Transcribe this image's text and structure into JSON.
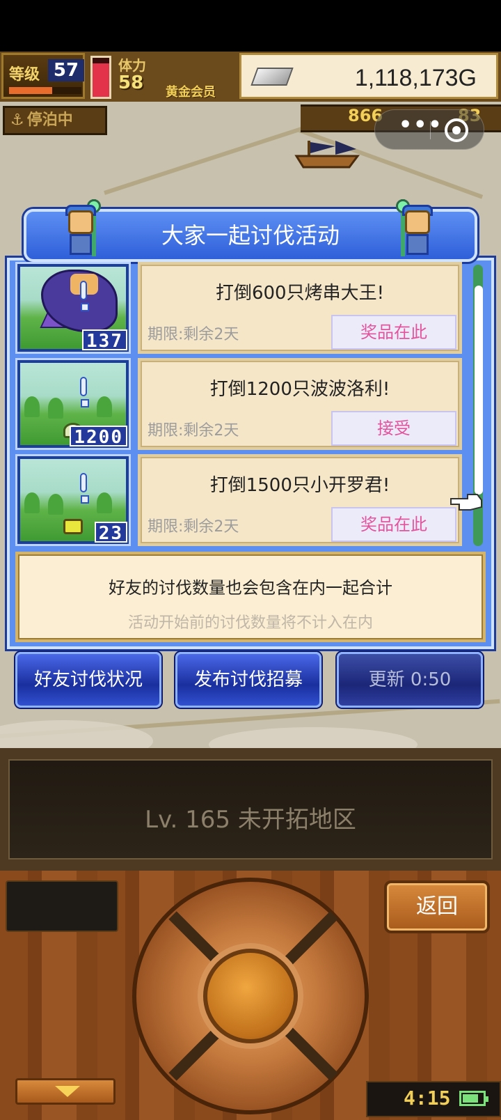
{
  "hud": {
    "level_label": "等级",
    "level": "57",
    "level_progress": 0.6,
    "stamina_label": "体力",
    "stamina": "58",
    "stamina_gauge_fill": 0.85,
    "vip_label": "黄金会员",
    "gold": "1,118,173G",
    "dock_status": "停泊中",
    "res_a": "866",
    "res_b": "83"
  },
  "dialog": {
    "title": "大家一起讨伐活动",
    "quests": [
      {
        "count": "137",
        "title": "打倒600只烤串大王!",
        "deadline": "期限:剩余2天",
        "button": "奖品在此"
      },
      {
        "count": "1200",
        "title": "打倒1200只波波洛利!",
        "deadline": "期限:剩余2天",
        "button": "接受"
      },
      {
        "count": "23",
        "title": "打倒1500只小开罗君!",
        "deadline": "期限:剩余2天",
        "button": "奖品在此"
      }
    ],
    "note_main": "好友的讨伐数量也会包含在内一起合计",
    "note_sub": "活动开始前的讨伐数量将不计入在内",
    "buttons": {
      "friend_status": "好友讨伐状况",
      "post_recruit": "发布讨伐招募",
      "refresh": "更新 0:50"
    }
  },
  "bottom": {
    "region": "Lv. 165 未开拓地区",
    "back": "返回",
    "clock": "4:15",
    "battery_level": 0.8
  },
  "colors": {
    "title_blue": "#2f5fd9",
    "card_bg": "#f5e6c8",
    "prize_text": "#e2559c",
    "wood": "#8b4a1c"
  }
}
